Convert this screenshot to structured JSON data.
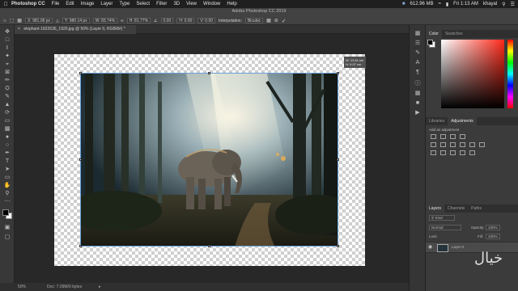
{
  "menubar": {
    "app_name": "Photoshop CC",
    "items": [
      "File",
      "Edit",
      "Image",
      "Layer",
      "Type",
      "Select",
      "Filter",
      "3D",
      "View",
      "Window",
      "Help"
    ],
    "memory": "612.96 MB",
    "clock": "Fri 1:13 AM",
    "user": "khayal"
  },
  "options": {
    "window_title": "Adobe Photoshop CC 2019",
    "x": "X: 981.06 px",
    "y": "Y: 980.14 px",
    "w": "W: 83.74%",
    "h": "H: 81.77%",
    "angle": "0.00",
    "hskew": "H: 0.00",
    "vskew": "V: 0.00",
    "interpolation_label": "Interpolation:",
    "interpolation_value": "Bicubic"
  },
  "document": {
    "tab_label": "elephant-1822636_1920.jpg @ 50% (Layer 0, RGB/8#) *",
    "transform_w": "W: 13.61 cm",
    "transform_h": "H: 9.07 cm"
  },
  "status": {
    "zoom": "50%",
    "doc_size": "Doc: 7.09M/0 bytes"
  },
  "panels": {
    "color_tabs": [
      "Color",
      "Swatches"
    ],
    "libraries_tabs": [
      "Libraries",
      "Adjustments"
    ],
    "add_adjustment": "Add an adjustment",
    "layers_tabs": [
      "Layers",
      "Channels",
      "Paths"
    ],
    "kind_label": "Kind",
    "blend_mode": "Normal",
    "opacity_label": "Opacity:",
    "opacity_value": "100%",
    "lock_label": "Lock:",
    "fill_label": "Fill:",
    "fill_value": "100%",
    "layer_name": "Layer 0"
  },
  "colors": {
    "accent": "#6aa0d8",
    "picker_hue": "#ff2a1a"
  }
}
